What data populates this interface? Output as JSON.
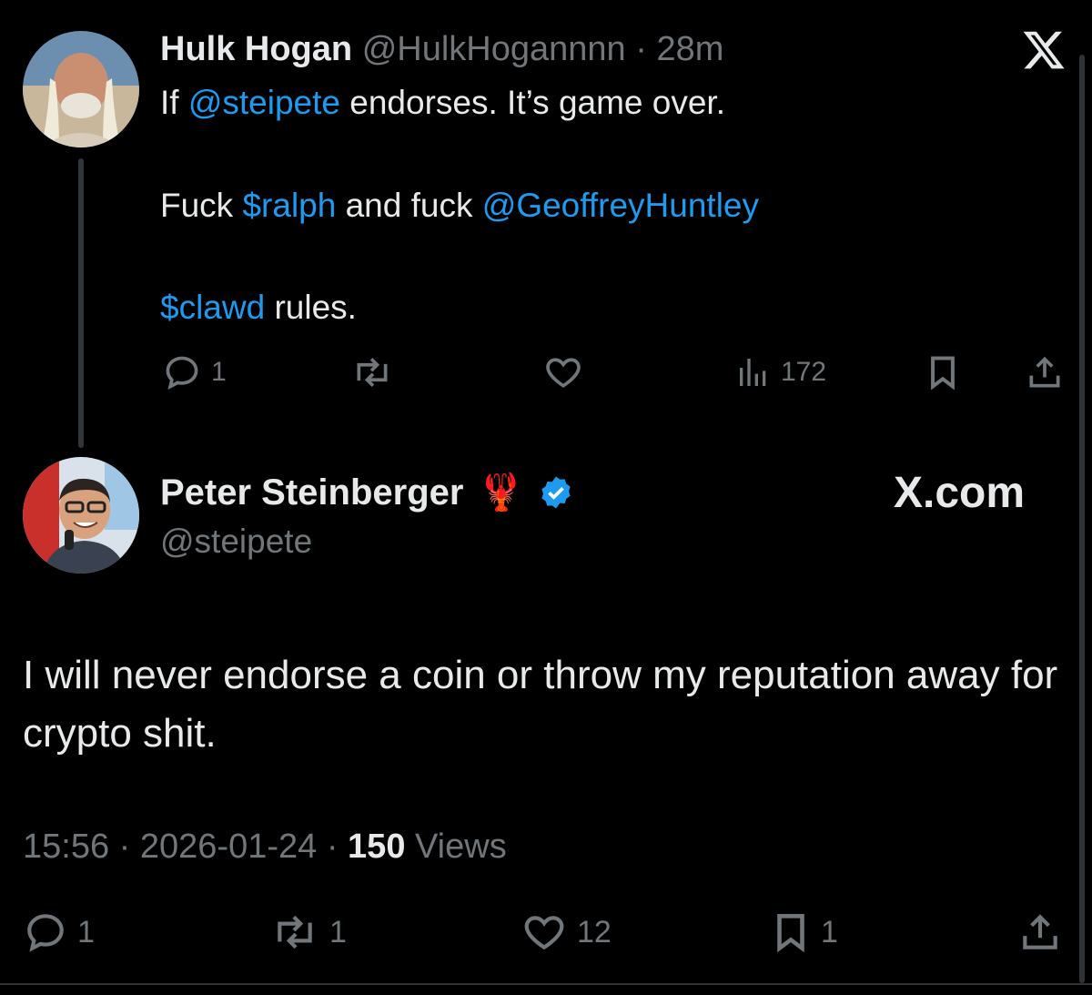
{
  "parent": {
    "name": "Hulk Hogan",
    "handle": "@HulkHogannnn",
    "separator": " · ",
    "time": "28m",
    "line1": {
      "pre": "If ",
      "mention": "@steipete",
      "post": " endorses. It’s game over."
    },
    "line2": {
      "pre": "Fuck ",
      "cashtag": "$ralph",
      "mid": " and fuck ",
      "mention": "@GeoffreyHuntley"
    },
    "line3": {
      "cashtag": "$clawd",
      "post": " rules."
    },
    "actions": {
      "replies": "1",
      "reposts": "",
      "likes": "",
      "views": "172"
    }
  },
  "reply": {
    "name": "Peter Steinberger",
    "emoji": "🦞",
    "handle": "@steipete",
    "brand": "X.com",
    "text": "I will never endorse a coin or throw my reputation away for crypto shit.",
    "time": "15:56",
    "date": "2026-01-24",
    "views_count": "150",
    "views_label": "Views",
    "separator": " · ",
    "actions": {
      "replies": "1",
      "reposts": "1",
      "likes": "12",
      "bookmarks": "1"
    }
  },
  "colors": {
    "accent": "#1d9bf0",
    "muted": "#71767b",
    "text": "#e7e9ea",
    "background": "#000000"
  },
  "icons": [
    "x-logo-icon",
    "reply-icon",
    "repost-icon",
    "like-icon",
    "views-icon",
    "bookmark-icon",
    "share-icon",
    "verified-badge-icon"
  ]
}
